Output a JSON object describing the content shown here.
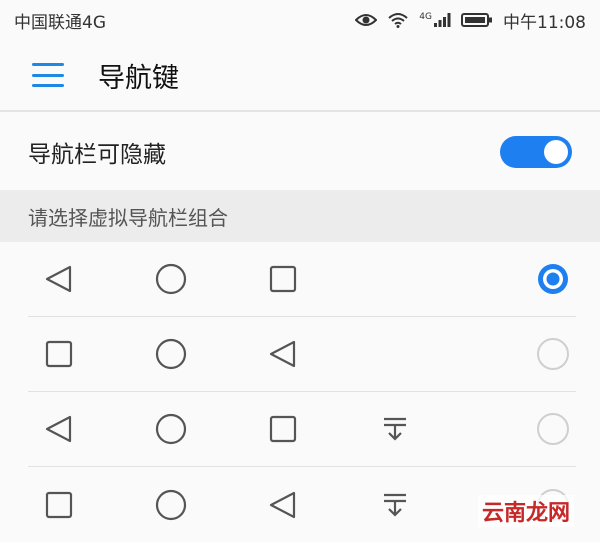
{
  "status_bar": {
    "carrier": "中国联通4G",
    "network_badge": "4G",
    "time": "中午11:08",
    "icons": [
      "eye-icon",
      "wifi-icon",
      "signal-icon",
      "battery-icon"
    ]
  },
  "app_bar": {
    "title": "导航键",
    "menu_icon": "menu-icon"
  },
  "toggle_setting": {
    "label": "导航栏可隐藏",
    "enabled": true
  },
  "section": {
    "header": "请选择虚拟导航栏组合"
  },
  "options": [
    {
      "keys": [
        "back",
        "home",
        "recent"
      ],
      "selected": true
    },
    {
      "keys": [
        "recent",
        "home",
        "back"
      ],
      "selected": false
    },
    {
      "keys": [
        "back",
        "home",
        "recent",
        "notification"
      ],
      "selected": false
    },
    {
      "keys": [
        "recent",
        "home",
        "back",
        "notification"
      ],
      "selected": false
    }
  ],
  "watermark": "云南龙网",
  "colors": {
    "accent": "#1e7ff0",
    "divider": "#e2e2e2",
    "section_bg": "#ececec"
  }
}
